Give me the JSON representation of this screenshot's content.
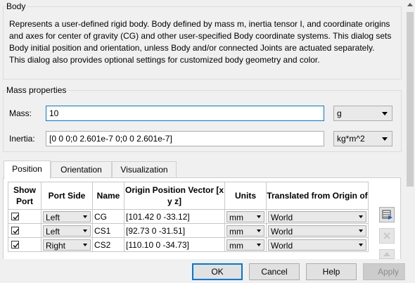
{
  "body_section": {
    "title": "Body",
    "description": "Represents a user-defined rigid body. Body defined by mass m, inertia tensor I, and coordinate origins and axes for center of gravity (CG) and other user-specified Body coordinate systems. This dialog sets Body initial position and orientation, unless Body and/or connected Joints are actuated separately. This dialog also provides optional settings for customized body geometry and color."
  },
  "mass_properties": {
    "title": "Mass properties",
    "mass_label": "Mass:",
    "mass_value": "10",
    "mass_unit": "g",
    "inertia_label": "Inertia:",
    "inertia_value": "[0 0 0;0 2.601e-7 0;0 0 2.601e-7]",
    "inertia_unit": "kg*m^2"
  },
  "tabs": [
    {
      "label": "Position"
    },
    {
      "label": "Orientation"
    },
    {
      "label": "Visualization"
    }
  ],
  "table": {
    "headers": {
      "show_port": "Show Port",
      "port_side": "Port Side",
      "name": "Name",
      "origin_position": "Origin Position Vector [x y z]",
      "units": "Units",
      "translated": "Translated from Origin of"
    },
    "rows": [
      {
        "show_port": true,
        "port_side": "Left",
        "name": "CG",
        "origin": "[101.42 0 -33.12]",
        "units": "mm",
        "translated": "World"
      },
      {
        "show_port": true,
        "port_side": "Left",
        "name": "CS1",
        "origin": "[92.73 0 -31.51]",
        "units": "mm",
        "translated": "World"
      },
      {
        "show_port": true,
        "port_side": "Right",
        "name": "CS2",
        "origin": "[110.10 0 -34.73]",
        "units": "mm",
        "translated": "World"
      }
    ]
  },
  "buttons": {
    "ok": "OK",
    "cancel": "Cancel",
    "help": "Help",
    "apply": "Apply"
  },
  "colors": {
    "accent": "#0078d7",
    "dialog_bg": "#f0f0f0"
  }
}
